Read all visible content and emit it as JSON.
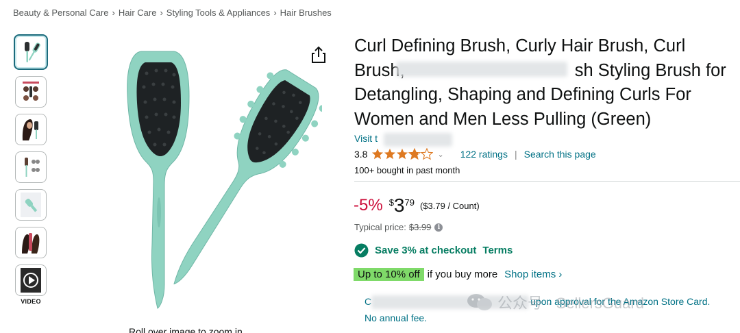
{
  "breadcrumb": {
    "items": [
      "Beauty & Personal Care",
      "Hair Care",
      "Styling Tools & Appliances",
      "Hair Brushes"
    ],
    "separator": "›"
  },
  "gallery": {
    "video_label": "VIDEO",
    "rollover_text": "Roll over image to zoom in",
    "accent_color": "#1b6b7c"
  },
  "product": {
    "title_line1": "Curl Defining Brush, Curly Hair Brush, Curl",
    "title_line2": "Brush,",
    "title_line2_end": "sh Styling Brush for",
    "title_line3": "Detangling, Shaping and Defining Curls For",
    "title_line4": "Women and Men Less Pulling (Green)",
    "visit_store": "Visit t",
    "rating_value": "3.8",
    "rating_stars": 3.8,
    "ratings_count": "122 ratings",
    "search_page": "Search this page",
    "bought": "100+ bought in past month"
  },
  "price": {
    "discount": "-5%",
    "currency": "$",
    "whole": "3",
    "fraction": "79",
    "per_count": "($3.79 / Count)",
    "typical_label": "Typical price:",
    "typical_value": "$3.99",
    "discount_color": "#cc0c39"
  },
  "promo": {
    "save_text": "Save 3% at checkout",
    "terms": "Terms",
    "badge": "Up to 10% off",
    "if_buy_more": "if you buy more",
    "shop_items": "Shop items ›",
    "card_line_start": "C",
    "card_line_end": "upon approval for the Amazon Store Card.",
    "no_fee": "No annual fee.",
    "green_color": "#067d62",
    "badge_color": "#7fda69"
  },
  "watermark": {
    "text": "公众号 · SellersGuard"
  }
}
